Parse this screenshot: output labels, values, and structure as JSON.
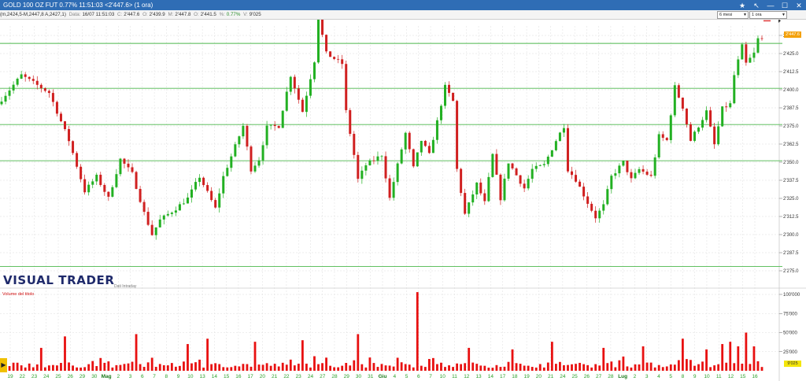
{
  "titlebar": {
    "title": "GOLD 100 OZ FUT 0.77% 11:51:03   <2'447.6> (1 ora)"
  },
  "infobar": {
    "prefix": "(m,2424,5-M,2447,8 A,2427,1)",
    "date_label": "Data:",
    "date_value": "16/07 11:51:03",
    "close_label": "C:",
    "close_value": "2'447.6",
    "open_label": "O:",
    "open_value": "2'439.9",
    "high_label": "M:",
    "high_value": "2'447.8",
    "low_label": "O:",
    "low_value": "2'441.5",
    "pct_label": "%:",
    "pct_value": "0.77%",
    "vol_label": "V:",
    "vol_value": "9'025"
  },
  "controls": {
    "period": "6 mesi",
    "interval": "1 ora"
  },
  "logo": {
    "text": "VISUAL TRADER",
    "subtitle": "Dati Intraday"
  },
  "price_tag": "2'447.6",
  "volume_tag": "9'025",
  "colors": {
    "up": "#22b022",
    "down": "#d02020",
    "volume": "#e81010",
    "gridline": "#dddddd",
    "support": "#4cb84c",
    "resistance": "#e04040",
    "titlebar": "#2f6db5"
  },
  "chart_data": [
    {
      "type": "candlestick",
      "title": "",
      "ylim": [
        2270,
        2460
      ],
      "price_axis_ticks": [
        "2'450.0",
        "2'437.5",
        "2'425.0",
        "2'412.5",
        "2'400.0",
        "2'387.5",
        "2'375.0",
        "2'362.5",
        "2'350.0",
        "2'337.5",
        "2'325.0",
        "2'312.5",
        "2'300.0",
        "2'287.5",
        "2'275.0"
      ],
      "price_axis_values": [
        2450,
        2437.5,
        2425,
        2412.5,
        2400,
        2387.5,
        2375,
        2362.5,
        2350,
        2337.5,
        2325,
        2312.5,
        2300,
        2287.5,
        2275
      ],
      "x_tick_labels": [
        "19",
        "22",
        "23",
        "24",
        "25",
        "26",
        "29",
        "30",
        "Mag",
        "2",
        "3",
        "6",
        "7",
        "8",
        "9",
        "10",
        "13",
        "14",
        "15",
        "16",
        "17",
        "20",
        "21",
        "22",
        "23",
        "24",
        "27",
        "28",
        "29",
        "30",
        "31",
        "Giu",
        "4",
        "5",
        "6",
        "7",
        "10",
        "11",
        "12",
        "13",
        "14",
        "17",
        "18",
        "19",
        "20",
        "21",
        "24",
        "25",
        "26",
        "27",
        "28",
        "Lug",
        "2",
        "3",
        "4",
        "5",
        "8",
        "9",
        "10",
        "11",
        "12",
        "15",
        "16"
      ],
      "horizontal_levels": [
        {
          "value": 2457.5,
          "color": "resistance"
        },
        {
          "value": 2432,
          "color": "support"
        },
        {
          "value": 2401,
          "color": "support"
        },
        {
          "value": 2376,
          "color": "support"
        },
        {
          "value": 2351,
          "color": "support"
        },
        {
          "value": 2278,
          "color": "support"
        }
      ],
      "last_price": 2447.6,
      "close_path": [
        [
          0,
          2390
        ],
        [
          6,
          2410
        ],
        [
          13,
          2398
        ],
        [
          18,
          2365
        ],
        [
          22,
          2330
        ],
        [
          25,
          2340
        ],
        [
          28,
          2325
        ],
        [
          31,
          2352
        ],
        [
          34,
          2342
        ],
        [
          37,
          2315
        ],
        [
          39,
          2300
        ],
        [
          41,
          2310
        ],
        [
          45,
          2318
        ],
        [
          48,
          2325
        ],
        [
          51,
          2340
        ],
        [
          55,
          2318
        ],
        [
          57,
          2340
        ],
        [
          62,
          2375
        ],
        [
          64,
          2345
        ],
        [
          66,
          2352
        ],
        [
          68,
          2374
        ],
        [
          71,
          2375
        ],
        [
          74,
          2410
        ],
        [
          77,
          2385
        ],
        [
          80,
          2420
        ],
        [
          81,
          2450
        ],
        [
          83,
          2425
        ],
        [
          87,
          2418
        ],
        [
          88,
          2385
        ],
        [
          90,
          2355
        ],
        [
          91,
          2338
        ],
        [
          93,
          2348
        ],
        [
          97,
          2355
        ],
        [
          99,
          2325
        ],
        [
          101,
          2348
        ],
        [
          103,
          2370
        ],
        [
          105,
          2346
        ],
        [
          107,
          2365
        ],
        [
          109,
          2355
        ],
        [
          111,
          2378
        ],
        [
          113,
          2402
        ],
        [
          115,
          2392
        ],
        [
          116,
          2345
        ],
        [
          118,
          2314
        ],
        [
          121,
          2335
        ],
        [
          123,
          2322
        ],
        [
          125,
          2355
        ],
        [
          127,
          2325
        ],
        [
          129,
          2350
        ],
        [
          133,
          2332
        ],
        [
          135,
          2345
        ],
        [
          138,
          2348
        ],
        [
          141,
          2365
        ],
        [
          143,
          2375
        ],
        [
          144,
          2345
        ],
        [
          146,
          2338
        ],
        [
          149,
          2322
        ],
        [
          151,
          2312
        ],
        [
          153,
          2320
        ],
        [
          155,
          2340
        ],
        [
          158,
          2350
        ],
        [
          160,
          2338
        ],
        [
          162,
          2345
        ],
        [
          165,
          2340
        ],
        [
          167,
          2368
        ],
        [
          169,
          2365
        ],
        [
          171,
          2402
        ],
        [
          173,
          2388
        ],
        [
          175,
          2365
        ],
        [
          177,
          2375
        ],
        [
          179,
          2385
        ],
        [
          181,
          2362
        ],
        [
          183,
          2387
        ],
        [
          185,
          2390
        ],
        [
          186,
          2410
        ],
        [
          188,
          2430
        ],
        [
          189,
          2418
        ],
        [
          191,
          2425
        ],
        [
          192,
          2435
        ]
      ]
    },
    {
      "type": "bar",
      "title": "Volume del titolo",
      "ylim": [
        0,
        110000
      ],
      "y_tick_labels": [
        "100'000",
        "75'000",
        "50'000",
        "25'000"
      ],
      "y_tick_values": [
        100000,
        75000,
        50000,
        25000
      ],
      "last_value": 9025,
      "spikes": [
        [
          0,
          12000
        ],
        [
          10,
          30000
        ],
        [
          16,
          45000
        ],
        [
          34,
          48000
        ],
        [
          47,
          35000
        ],
        [
          52,
          42000
        ],
        [
          64,
          38000
        ],
        [
          76,
          40000
        ],
        [
          90,
          48000
        ],
        [
          105,
          103000
        ],
        [
          118,
          30000
        ],
        [
          129,
          28000
        ],
        [
          139,
          38000
        ],
        [
          152,
          30000
        ],
        [
          162,
          32000
        ],
        [
          172,
          42000
        ],
        [
          178,
          28000
        ],
        [
          182,
          35000
        ],
        [
          184,
          38000
        ],
        [
          186,
          32000
        ],
        [
          188,
          50000
        ],
        [
          190,
          32000
        ]
      ]
    }
  ]
}
